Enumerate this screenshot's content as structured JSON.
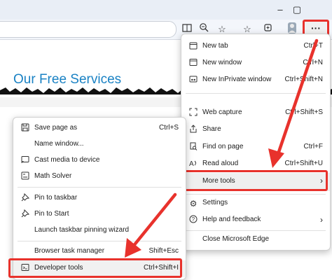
{
  "browser": {
    "minimize": "–",
    "maximize": "▢",
    "more_button": "···"
  },
  "page": {
    "heading": "Our Free Services"
  },
  "main_menu": {
    "items": [
      {
        "label": "New tab",
        "shortcut": "Ctrl+T",
        "icon": "new-tab-icon"
      },
      {
        "label": "New window",
        "shortcut": "Ctrl+N",
        "icon": "new-window-icon"
      },
      {
        "label": "New InPrivate window",
        "shortcut": "Ctrl+Shift+N",
        "icon": "inprivate-icon"
      },
      {
        "label": "Web capture",
        "shortcut": "Ctrl+Shift+S",
        "icon": "web-capture-icon"
      },
      {
        "label": "Share",
        "shortcut": "",
        "icon": "share-icon"
      },
      {
        "label": "Find on page",
        "shortcut": "Ctrl+F",
        "icon": "find-icon"
      },
      {
        "label": "Read aloud",
        "shortcut": "Ctrl+Shift+U",
        "icon": "read-aloud-icon"
      },
      {
        "label": "More tools",
        "shortcut": "",
        "icon": ""
      },
      {
        "label": "Settings",
        "shortcut": "",
        "icon": "gear-icon"
      },
      {
        "label": "Help and feedback",
        "shortcut": "",
        "icon": "help-icon"
      },
      {
        "label": "Close Microsoft Edge",
        "shortcut": "",
        "icon": ""
      }
    ]
  },
  "more_tools_menu": {
    "items": [
      {
        "label": "Save page as",
        "shortcut": "Ctrl+S",
        "icon": "save-icon"
      },
      {
        "label": "Name window...",
        "shortcut": "",
        "icon": ""
      },
      {
        "label": "Cast media to device",
        "shortcut": "",
        "icon": "cast-icon"
      },
      {
        "label": "Math Solver",
        "shortcut": "",
        "icon": "math-solver-icon"
      },
      {
        "label": "Pin to taskbar",
        "shortcut": "",
        "icon": "pin-icon"
      },
      {
        "label": "Pin to Start",
        "shortcut": "",
        "icon": "pin-icon"
      },
      {
        "label": "Launch taskbar pinning wizard",
        "shortcut": "",
        "icon": ""
      },
      {
        "label": "Browser task manager",
        "shortcut": "Shift+Esc",
        "icon": ""
      },
      {
        "label": "Developer tools",
        "shortcut": "Ctrl+Shift+I",
        "icon": "developer-tools-icon"
      }
    ]
  },
  "colors": {
    "annotation_red": "#e8322c",
    "heading_blue": "#1a82c4"
  }
}
